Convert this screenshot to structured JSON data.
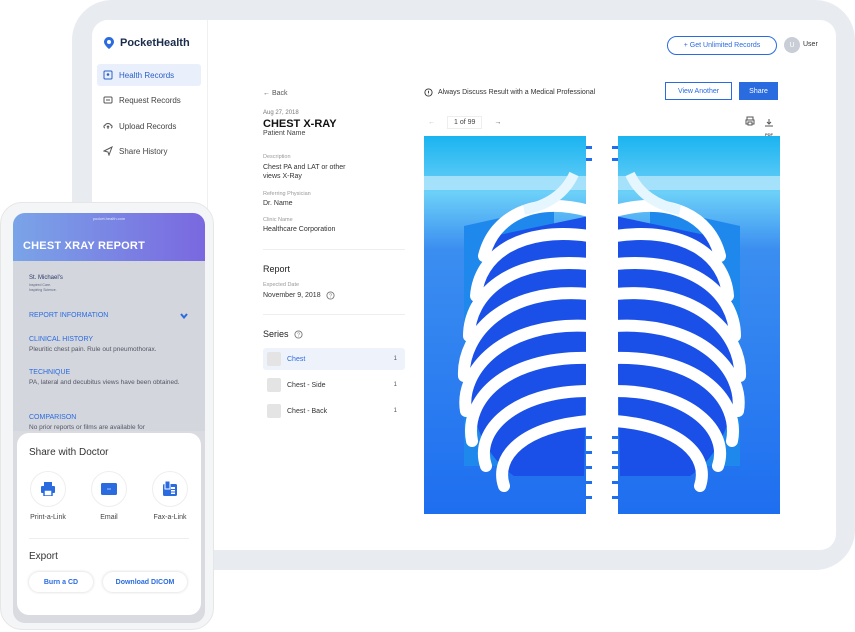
{
  "brand": {
    "name": "PocketHealth"
  },
  "sidebar": {
    "items": [
      {
        "label": "Health Records",
        "icon": "folder-icon",
        "active": true
      },
      {
        "label": "Request Records",
        "icon": "request-icon"
      },
      {
        "label": "Upload Records",
        "icon": "upload-icon"
      },
      {
        "label": "Share History",
        "icon": "share-icon"
      }
    ]
  },
  "topbar": {
    "unlimited_label": "+ Get Unlimited Records",
    "avatar_initial": "U",
    "user_label": "User"
  },
  "record": {
    "back": "← Back",
    "date": "Aug 27, 2018",
    "title": "CHEST X-RAY",
    "patient": "Patient Name",
    "desc_label": "Description",
    "desc_value": "Chest PA and LAT or other views X-Ray",
    "physician_label": "Referring Physician",
    "physician_value": "Dr. Name",
    "clinic_label": "Clinic Name",
    "clinic_value": "Healthcare Corporation"
  },
  "report": {
    "title": "Report",
    "expected_label": "Expected Date",
    "expected_value": "November 9, 2018"
  },
  "series": {
    "title": "Series",
    "items": [
      {
        "label": "Chest",
        "count": "1",
        "active": true
      },
      {
        "label": "Chest - Side",
        "count": "1"
      },
      {
        "label": "Chest - Back",
        "count": "1"
      }
    ]
  },
  "viewer": {
    "notice": "Always Discuss Result with a Medical Professional",
    "view_another": "View Another",
    "share": "Share",
    "pager": "1 of 99",
    "pdf_label": "PDF"
  },
  "phone": {
    "header_tiny": "pocket.health.com",
    "header_title": "CHEST XRAY REPORT",
    "org_name": "St. Michael's",
    "org_tagline": "Inspired Care. Inspiring Science.",
    "report_info": "REPORT INFORMATION",
    "clinical_h": "CLINICAL HISTORY",
    "clinical_b": "Pleuritic chest pain. Rule out pneumothorax.",
    "technique_h": "TECHNIQUE",
    "technique_b": "PA, lateral and decubitus views have been obtained.",
    "comparison_h": "COMPARISON",
    "comparison_b": "No prior reports or films are available for",
    "share_title": "Share with Doctor",
    "share_items": [
      {
        "label": "Print-a-Link",
        "icon": "printer-icon"
      },
      {
        "label": "Email",
        "icon": "email-icon"
      },
      {
        "label": "Fax-a-Link",
        "icon": "fax-icon"
      }
    ],
    "export_title": "Export",
    "burn_cd": "Burn a CD",
    "download_dicom": "Download DICOM"
  },
  "colors": {
    "accent": "#2a6be0",
    "xray_dark": "#1a4fe0",
    "xray_light": "#5fc8f5"
  }
}
